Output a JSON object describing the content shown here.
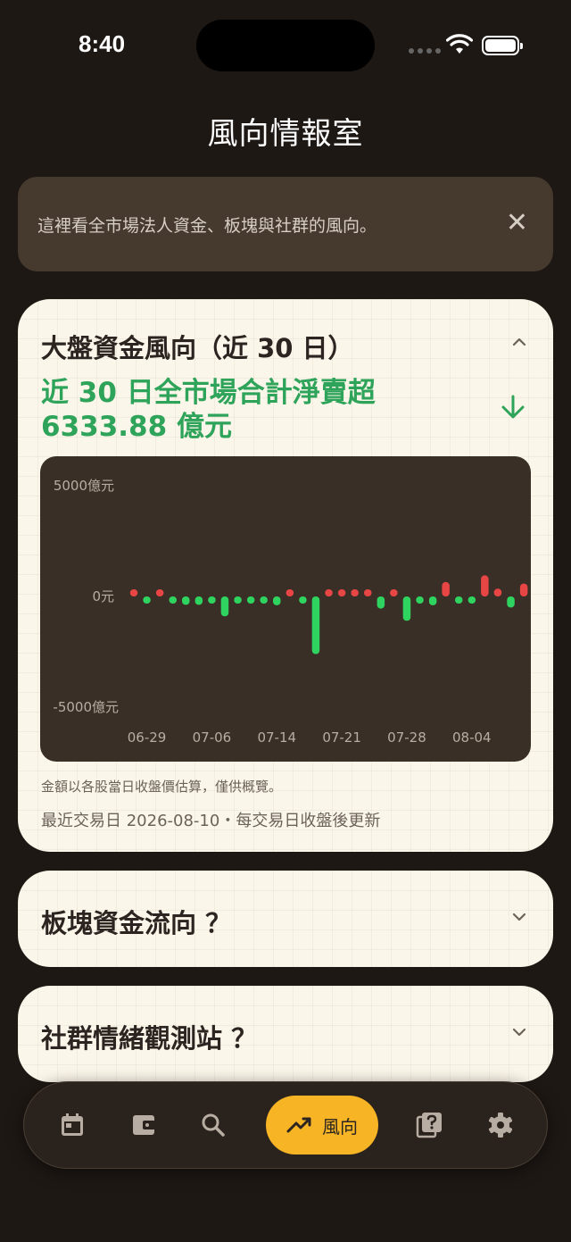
{
  "status": {
    "time": "8:40"
  },
  "header": {
    "title": "風向情報室"
  },
  "banner": {
    "text": "這裡看全市場法人資金、板塊與社群的風向。",
    "close": "✕"
  },
  "market_flow": {
    "title": "大盤資金風向（近 30 日）",
    "headline": "近 30 日全市場合計淨賣超 6333.88 億元",
    "note": "金額以各股當日收盤價估算，僅供概覽。",
    "updated": "最近交易日 2026-08-10・每交易日收盤後更新"
  },
  "sector_flow": {
    "title": "板塊資金流向 ？"
  },
  "social": {
    "title": "社群情緒觀測站 ？"
  },
  "tabbar": {
    "active_label": "風向"
  },
  "colors": {
    "up": "#e84545",
    "down": "#2fd35f",
    "accent": "#f7b526",
    "headline": "#2ea35a"
  },
  "chart_data": {
    "type": "bar",
    "y_ticks": [
      "5000億元",
      "0元",
      "-5000億元"
    ],
    "ylim": [
      -5000,
      5000
    ],
    "x_tick_labels": [
      "06-29",
      "07-06",
      "07-14",
      "07-21",
      "07-28",
      "08-04"
    ],
    "x_tick_positions": [
      1,
      6,
      11,
      16,
      21,
      26
    ],
    "series": [
      {
        "values": [
          160,
          -180,
          160,
          -300,
          -380,
          -380,
          -180,
          -900,
          -250,
          -150,
          -150,
          -400,
          160,
          -250,
          -2600,
          160,
          160,
          160,
          160,
          -550,
          160,
          -1100,
          -250,
          -400,
          650,
          -250,
          -250,
          950,
          350,
          -500,
          580
        ]
      }
    ]
  }
}
